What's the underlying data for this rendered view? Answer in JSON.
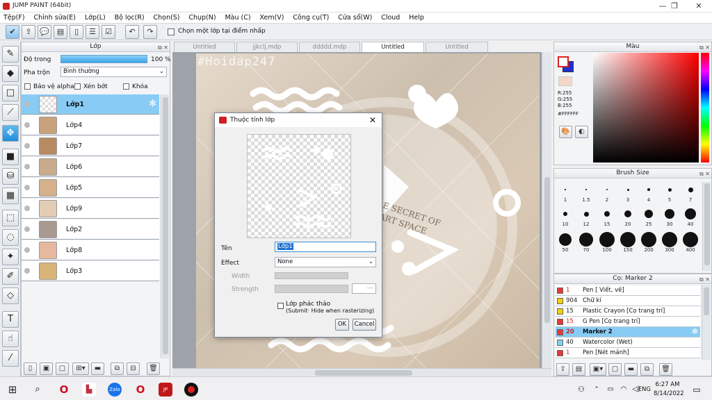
{
  "window": {
    "title": "JUMP PAINT (64bit)",
    "min": "—",
    "max": "❐",
    "close": "✕"
  },
  "menu": [
    "Tệp(F)",
    "Chỉnh sửa(E)",
    "Lớp(L)",
    "Bộ lọc(R)",
    "Chọn(S)",
    "Chụp(N)",
    "Màu (C)",
    "Xem(V)",
    "Công cụ(T)",
    "Cửa sổ(W)",
    "Cloud",
    "Help"
  ],
  "toolbar": {
    "pick_layer_label": "Chọn một lớp tại điểm nhấp"
  },
  "layer_panel": {
    "title": "Lớp",
    "opacity_label": "Độ trong",
    "opacity_value": "100 %",
    "opacity_fraction": 1.0,
    "blend_label": "Pha trộn",
    "blend_value": "Bình thường",
    "protect_alpha": "Bảo vệ alpha",
    "clip": "Xén bớt",
    "lock": "Khóa",
    "layers": [
      "Lớp1",
      "Lớp4",
      "Lớp7",
      "Lớp6",
      "Lớp5",
      "Lớp9",
      "Lớp2",
      "Lớp8",
      "Lớp3"
    ]
  },
  "tabs": [
    "Untitled",
    "jjkclj.mdp",
    "ddddd.mdp",
    "Untitled",
    "Untitled"
  ],
  "artwork": {
    "watermark": "#Hoidap247",
    "book_text": "E SECRET OF\nART SPACE"
  },
  "dialog": {
    "title": "Thuộc tính lớp",
    "name_label": "Tên",
    "name_value": "Lớp1",
    "effect_label": "Effect",
    "effect_value": "None",
    "width_label": "Width",
    "strength_label": "Strength",
    "strength_value": "---",
    "draft_label": "Lớp phác thảo",
    "draft_sub": "(Submit· Hide when rasterizing)",
    "ok": "OK",
    "cancel": "Cancel"
  },
  "color_panel": {
    "title": "Màu",
    "r": "R:255",
    "g": "G:255",
    "b": "B:255",
    "hex": "#FFFFFF"
  },
  "brush_size_panel": {
    "title": "Brush Size",
    "sizes": [
      "1",
      "1.5",
      "2",
      "3",
      "4",
      "5",
      "7",
      "10",
      "12",
      "15",
      "20",
      "25",
      "30",
      "40",
      "50",
      "70",
      "100",
      "150",
      "200",
      "300",
      "400"
    ]
  },
  "brush_panel": {
    "title": "Cọ: Marker 2",
    "brushes": [
      {
        "num": "1",
        "name": "Pen [ Viết, vẽ]",
        "color": "#e53935"
      },
      {
        "num": "904",
        "name": "Chữ kí",
        "color": "#f5d000"
      },
      {
        "num": "15",
        "name": "Plastic Crayon [Cọ trang trí]",
        "color": "#f5d000"
      },
      {
        "num": "15",
        "name": "G Pen [Cọ trang trí]",
        "color": "#e53935"
      },
      {
        "num": "20",
        "name": "Marker 2",
        "color": "#e53935"
      },
      {
        "num": "40",
        "name": "Watercolor (Wet)",
        "color": "#80d0f0"
      },
      {
        "num": "1",
        "name": "Pen [Nét mảnh]",
        "color": "#e53935"
      }
    ]
  },
  "taskbar": {
    "lang": "ENG",
    "time": "6:27 AM",
    "date": "8/14/2022"
  }
}
